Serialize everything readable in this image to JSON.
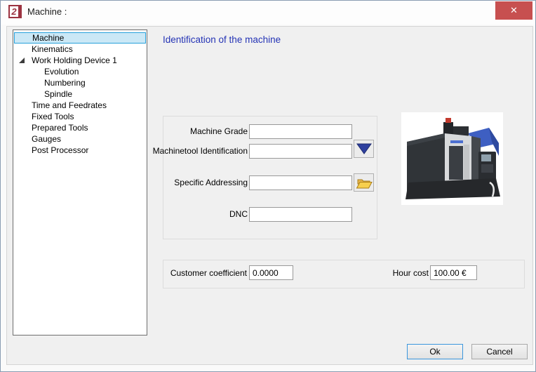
{
  "window": {
    "title": "Machine :"
  },
  "icons": {
    "app_glyph": "2",
    "close_glyph": "✕"
  },
  "tree": {
    "items": [
      {
        "label": "Machine",
        "level": 1,
        "selected": true
      },
      {
        "label": "Kinematics",
        "level": 1
      },
      {
        "label": "Work Holding Device 1",
        "level": 1,
        "expanded": true
      },
      {
        "label": "Evolution",
        "level": 2
      },
      {
        "label": "Numbering",
        "level": 2
      },
      {
        "label": "Spindle",
        "level": 2
      },
      {
        "label": "Time and Feedrates",
        "level": 1
      },
      {
        "label": "Fixed Tools",
        "level": 1
      },
      {
        "label": "Prepared Tools",
        "level": 1
      },
      {
        "label": "Gauges",
        "level": 1
      },
      {
        "label": "Post Processor",
        "level": 1
      }
    ]
  },
  "main": {
    "heading": "Identification of the machine",
    "identification": {
      "machine_grade": {
        "label": "Machine Grade",
        "value": ""
      },
      "machinetool_identification": {
        "label": "Machinetool Identification",
        "value": ""
      },
      "specific_addressing": {
        "label": "Specific Addressing",
        "value": ""
      },
      "dnc": {
        "label": "DNC",
        "value": ""
      }
    },
    "costs": {
      "customer_coefficient": {
        "label": "Customer coefficient",
        "value": "0.0000"
      },
      "hour_cost": {
        "label": "Hour cost",
        "value": "100.00 €"
      }
    }
  },
  "footer": {
    "ok_label": "Ok",
    "cancel_label": "Cancel"
  },
  "colors": {
    "close_button_red": "#c75050",
    "heading_blue": "#2433b5",
    "tree_selection_bg": "#cbe8f6",
    "tree_selection_border": "#26a0da",
    "dropdown_triangle_blue": "#2e3f9e",
    "folder_yellow": "#f7cf4e",
    "app_logo_maroon": "#9c3341"
  }
}
